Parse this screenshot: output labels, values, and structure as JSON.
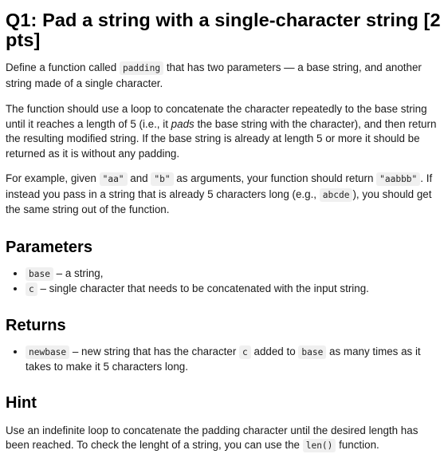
{
  "title": "Q1: Pad a string with a single-character string [2 pts]",
  "intro": {
    "t1": "Define a function called ",
    "code1": "padding",
    "t2": " that has two parameters — a base string, and another string made of a single character."
  },
  "description": {
    "t1": "The function should use a loop to concatenate the character repeatedly to the base string until it reaches a length of 5 (i.e., it ",
    "em": "pads",
    "t2": " the base string with the character), and then return the resulting modified string. If the base string is already at length 5 or more it should be returned as it is without any padding."
  },
  "example": {
    "t1": "For example, given ",
    "code1": "\"aa\"",
    "t2": " and ",
    "code2": "\"b\"",
    "t3": " as arguments, your function should return ",
    "code3": "\"aabbb\"",
    "t4": ". If instead you pass in a string that is already 5 characters long (e.g., ",
    "code4": "abcde",
    "t5": "), you should get the same string out of the function."
  },
  "parameters": {
    "heading": "Parameters",
    "items": [
      {
        "code": "base",
        "text": " – a string,"
      },
      {
        "code": "c",
        "text": " – single character that needs to be concatenated with the input string."
      }
    ]
  },
  "returns": {
    "heading": "Returns",
    "item": {
      "code1": "newbase",
      "t1": " – new string that has the character ",
      "code2": "c",
      "t2": " added to ",
      "code3": "base",
      "t3": " as many times as it takes to make it 5 characters long."
    }
  },
  "hint": {
    "heading": "Hint",
    "t1": "Use an indefinite loop to concatenate the padding character until the desired length has been reached. To check the lenght of a string, you can use the ",
    "code": "len()",
    "t2": " function."
  }
}
